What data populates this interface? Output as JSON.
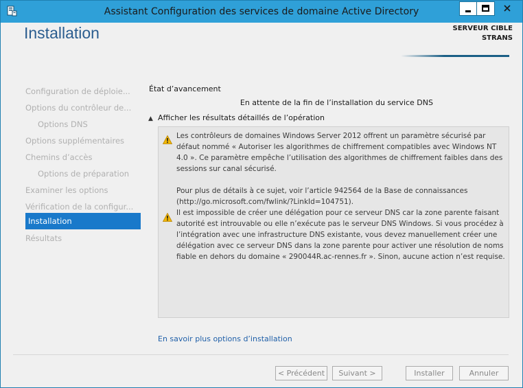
{
  "window": {
    "title": "Assistant Configuration des services de domaine Active Directory",
    "icon": "server-manager-icon",
    "controls": [
      "minimize-icon",
      "maximize-icon",
      "close-icon"
    ],
    "accent_color": "#2fa0d8"
  },
  "header": {
    "title": "Installation",
    "server_label": "SERVEUR CIBLE",
    "server_name": "STRANS"
  },
  "sidebar": {
    "items": [
      {
        "label": "Configuration de déploie...",
        "state": "disabled"
      },
      {
        "label": "Options du contrôleur de...",
        "state": "disabled"
      },
      {
        "label": "Options DNS",
        "state": "disabled"
      },
      {
        "label": "Options supplémentaires",
        "state": "disabled"
      },
      {
        "label": "Chemins d’accès",
        "state": "disabled"
      },
      {
        "label": "Options de préparation",
        "state": "disabled"
      },
      {
        "label": "Examiner les options",
        "state": "disabled"
      },
      {
        "label": "Vérification de la configur...",
        "state": "disabled"
      },
      {
        "label": "Installation",
        "state": "active"
      },
      {
        "label": "Résultats",
        "state": "disabled"
      }
    ],
    "active_color": "#1979ca"
  },
  "main": {
    "status_label": "État d’avancement",
    "status_text": "En attente de la fin de l’installation du service DNS",
    "details_toggle": "Afficher les résultats détaillés de l’opération",
    "messages": [
      {
        "icon": "warning-icon",
        "text": "Les contrôleurs de domaines Windows Server 2012 offrent un paramètre sécurisé par défaut nommé « Autoriser les algorithmes de chiffrement compatibles avec Windows NT 4.0 ». Ce paramètre empêche l’utilisation des algorithmes de chiffrement faibles dans des sessions sur canal sécurisé.",
        "text2": "Pour plus de détails à ce sujet, voir l’article 942564 de la Base de connaissances (http://go.microsoft.com/fwlink/?LinkId=104751)."
      },
      {
        "icon": "warning-icon",
        "text": "Il est impossible de créer une délégation pour ce serveur DNS car la zone parente faisant autorité est introuvable ou elle n’exécute pas le serveur DNS Windows. Si vous procédez à l’intégration avec une infrastructure DNS existante, vous devez manuellement créer une délégation avec ce serveur DNS dans la zone parente pour activer une résolution de noms fiable en dehors du domaine « 290044R.ac-rennes.fr ». Sinon, aucune action n’est requise."
      }
    ],
    "more_link": "En savoir plus options d’installation"
  },
  "footer": {
    "prev_label": "< Précédent",
    "next_label": "Suivant >",
    "install_label": "Installer",
    "cancel_label": "Annuler"
  }
}
